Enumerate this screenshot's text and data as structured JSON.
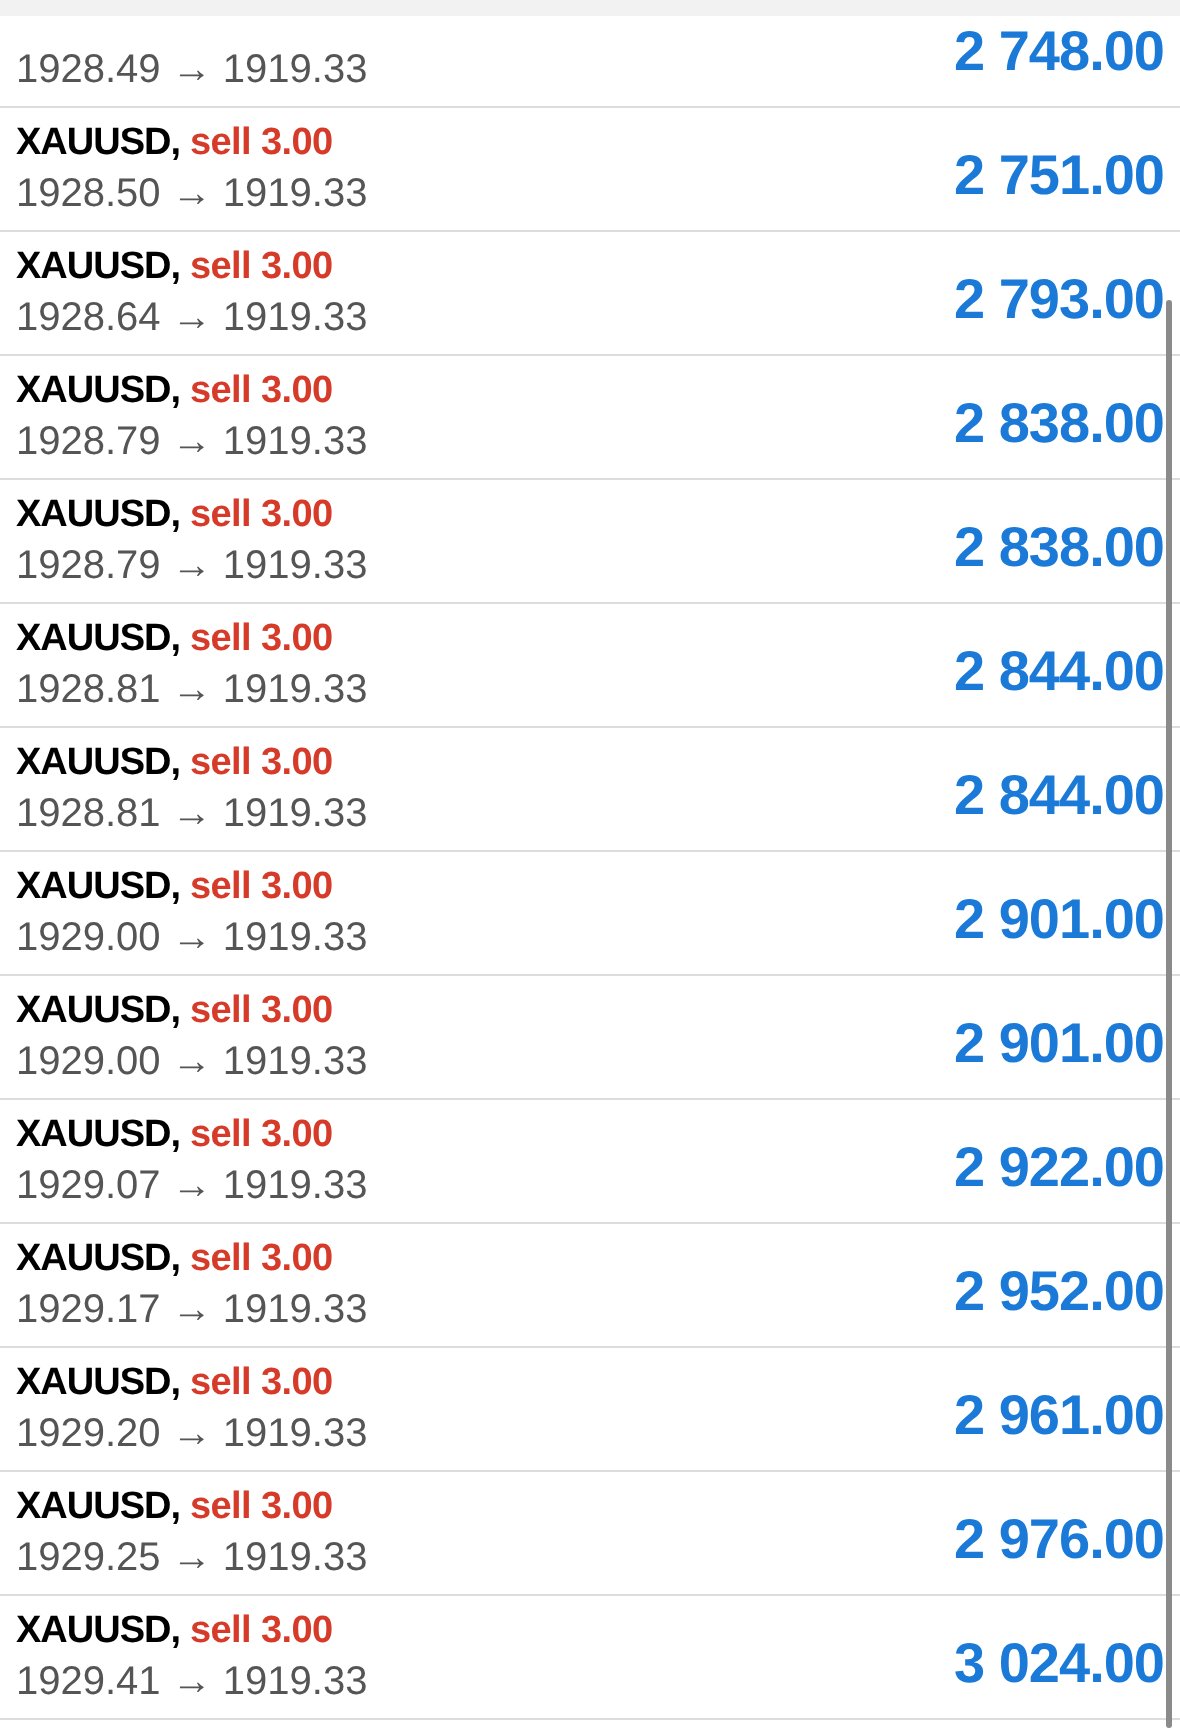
{
  "trades": [
    {
      "prices": "1928.49 → 1919.33",
      "profit": "2 748.00"
    },
    {
      "symbol": "XAUUSD,",
      "order": "sell 3.00",
      "prices": "1928.50 → 1919.33",
      "profit": "2 751.00"
    },
    {
      "symbol": "XAUUSD,",
      "order": "sell 3.00",
      "prices": "1928.64 → 1919.33",
      "profit": "2 793.00"
    },
    {
      "symbol": "XAUUSD,",
      "order": "sell 3.00",
      "prices": "1928.79 → 1919.33",
      "profit": "2 838.00"
    },
    {
      "symbol": "XAUUSD,",
      "order": "sell 3.00",
      "prices": "1928.79 → 1919.33",
      "profit": "2 838.00"
    },
    {
      "symbol": "XAUUSD,",
      "order": "sell 3.00",
      "prices": "1928.81 → 1919.33",
      "profit": "2 844.00"
    },
    {
      "symbol": "XAUUSD,",
      "order": "sell 3.00",
      "prices": "1928.81 → 1919.33",
      "profit": "2 844.00"
    },
    {
      "symbol": "XAUUSD,",
      "order": "sell 3.00",
      "prices": "1929.00 → 1919.33",
      "profit": "2 901.00"
    },
    {
      "symbol": "XAUUSD,",
      "order": "sell 3.00",
      "prices": "1929.00 → 1919.33",
      "profit": "2 901.00"
    },
    {
      "symbol": "XAUUSD,",
      "order": "sell 3.00",
      "prices": "1929.07 → 1919.33",
      "profit": "2 922.00"
    },
    {
      "symbol": "XAUUSD,",
      "order": "sell 3.00",
      "prices": "1929.17 → 1919.33",
      "profit": "2 952.00"
    },
    {
      "symbol": "XAUUSD,",
      "order": "sell 3.00",
      "prices": "1929.20 → 1919.33",
      "profit": "2 961.00"
    },
    {
      "symbol": "XAUUSD,",
      "order": "sell 3.00",
      "prices": "1929.25 → 1919.33",
      "profit": "2 976.00"
    },
    {
      "symbol": "XAUUSD,",
      "order": "sell 3.00",
      "prices": "1929.41 → 1919.33",
      "profit": "3 024.00"
    }
  ]
}
